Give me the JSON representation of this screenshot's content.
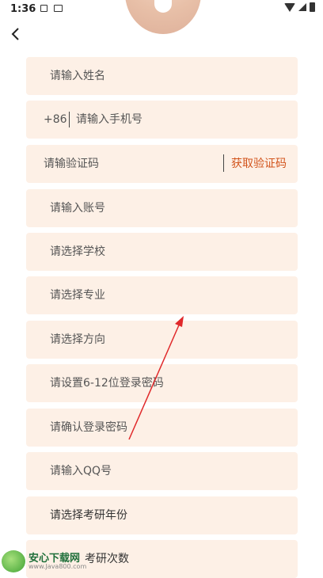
{
  "status_bar": {
    "time": "1:36",
    "icons": [
      "a-notification-icon",
      "screen-notification-icon",
      "wifi-icon",
      "signal-icon",
      "battery-icon"
    ]
  },
  "header": {
    "back_icon": "chevron-left-icon",
    "avatar": "avatar-placeholder"
  },
  "form": {
    "name_placeholder": "请输入姓名",
    "phone_prefix": "+86",
    "phone_placeholder": "请输入手机号",
    "code_placeholder": "请输验证码",
    "get_code_label": "获取验证码",
    "account_placeholder": "请输入账号",
    "school_placeholder": "请选择学校",
    "major_placeholder": "请选择专业",
    "direction_placeholder": "请选择方向",
    "password_placeholder": "请设置6-12位登录密码",
    "confirm_password_placeholder": "请确认登录密码",
    "qq_placeholder": "请输入QQ号",
    "exam_year_placeholder": "请选择考研年份",
    "exam_count_placeholder": "考研次数"
  },
  "watermark": {
    "title": "安心下载网",
    "url": "www.Java800.com",
    "logo_text": "软件\n免费",
    "sub": "免费"
  },
  "colors": {
    "field_bg": "#fdf0e6",
    "accent": "#d2541c",
    "annotation_arrow": "#e0282a"
  }
}
